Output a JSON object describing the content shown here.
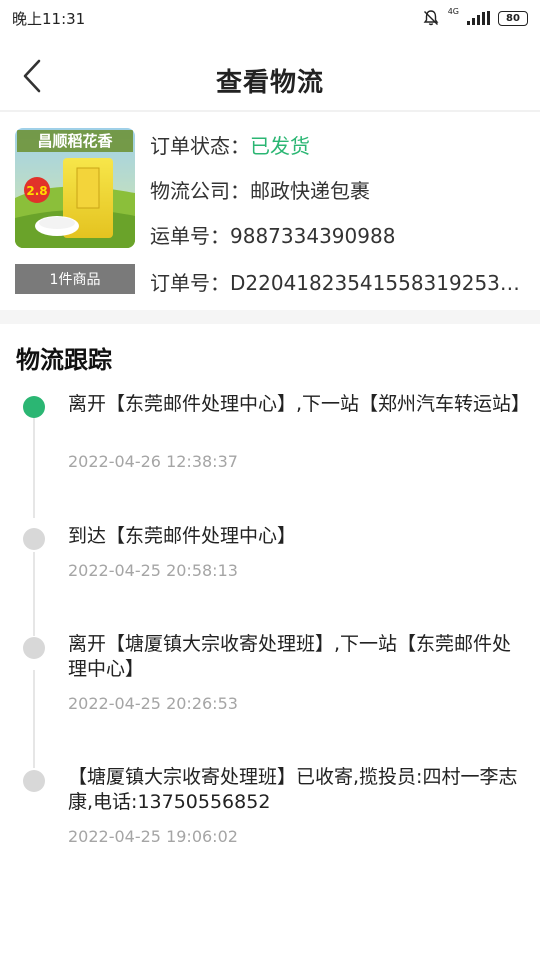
{
  "status_bar": {
    "time": "晚上11:31",
    "network": "4G",
    "battery": "80"
  },
  "header": {
    "title": "查看物流",
    "back_icon": "chevron-left-icon"
  },
  "order": {
    "item_count": "1件商品",
    "status_label": "订单状态：",
    "status_value": "已发货",
    "status_color": "#2bb673",
    "carrier_label": "物流公司：",
    "carrier_value": "邮政快递包裹",
    "waybill_label": "运单号：",
    "waybill_value": "9887334390988",
    "order_no_label": "订单号：",
    "order_no_value": "D220418235415583192538…",
    "product_image": {
      "brand_text": "昌顺稻花香",
      "badge": "2.8"
    }
  },
  "tracking": {
    "title": "物流跟踪",
    "active_color": "#2bb673",
    "events": [
      {
        "text": "离开【东莞邮件处理中心】,下一站【郑州汽车转运站】",
        "time": "2022-04-26 12:38:37",
        "active": true
      },
      {
        "text": "到达【东莞邮件处理中心】",
        "time": "2022-04-25 20:58:13",
        "active": false
      },
      {
        "text": "离开【塘厦镇大宗收寄处理班】,下一站【东莞邮件处理中心】",
        "time": "2022-04-25 20:26:53",
        "active": false
      },
      {
        "text": "【塘厦镇大宗收寄处理班】已收寄,揽投员:四村一李志康,电话:13750556852",
        "time": "2022-04-25 19:06:02",
        "active": false
      }
    ]
  }
}
